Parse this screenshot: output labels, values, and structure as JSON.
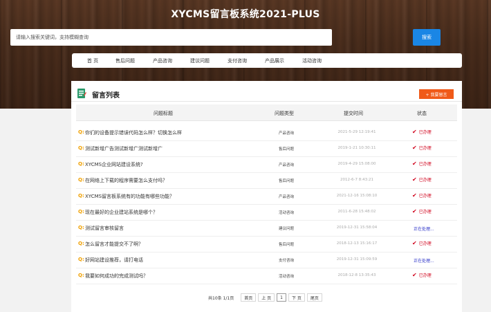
{
  "site": {
    "title": "XYCMS留言板系统2021-PLUS"
  },
  "search": {
    "placeholder": "请输入搜索关键词，支持模糊查询",
    "button_label": "搜索"
  },
  "nav": {
    "items": [
      "首 页",
      "售后问题",
      "产品咨询",
      "建议问题",
      "支付咨询",
      "产品展示",
      "活动咨询"
    ]
  },
  "panel": {
    "title": "留言列表",
    "post_button": "+ 我要留言"
  },
  "table": {
    "headers": [
      "问题标题",
      "问题类型",
      "提交时间",
      "状态"
    ],
    "rows": [
      {
        "title": "你们的设备提示错误代码怎么样？切换怎么样",
        "type": "产品咨询",
        "time": "2021-5-29 12:19:41",
        "status": "已办理",
        "status_kind": "done"
      },
      {
        "title": "测试新增广告测试新增广测试新增广",
        "type": "售后问题",
        "time": "2019-1-21 10:30:11",
        "status": "已办理",
        "status_kind": "done"
      },
      {
        "title": "XYCMS企业网站建设系统?",
        "type": "产品咨询",
        "time": "2019-4-29 15:08:00",
        "status": "已办理",
        "status_kind": "done"
      },
      {
        "title": "在网络上下载的程序需要怎么支付吗？",
        "type": "售后问题",
        "time": "2012-6-7 8:43:21",
        "status": "已办理",
        "status_kind": "done"
      },
      {
        "title": "XYCMS留言板系统有的功能有哪些功能？",
        "type": "产品咨询",
        "time": "2021-12-16 15:08:10",
        "status": "已办理",
        "status_kind": "done"
      },
      {
        "title": "现在最好的企业建站系统是哪个？",
        "type": "活动咨询",
        "time": "2011-6-28 15:48:02",
        "status": "已办理",
        "status_kind": "done"
      },
      {
        "title": "测试留言审核留言",
        "type": "建议问题",
        "time": "2019-12-31 15:58:04",
        "status": "正在处理...",
        "status_kind": "pending"
      },
      {
        "title": "怎么留言才能提交不了啊？",
        "type": "售后问题",
        "time": "2018-12-13 15:16:17",
        "status": "已办理",
        "status_kind": "done"
      },
      {
        "title": "好网站建设推荐，请打电话",
        "type": "支付咨询",
        "time": "2019-12-31 15:09:59",
        "status": "正在处理...",
        "status_kind": "pending"
      },
      {
        "title": "我要如何成功的完成测试吗？",
        "type": "活动咨询",
        "time": "2018-12-8 13:35:43",
        "status": "已办理",
        "status_kind": "done"
      }
    ]
  },
  "pager": {
    "info": "共10条 1/1页",
    "first": "首页",
    "prev": "上 页",
    "current": "1",
    "next": "下 页",
    "last": "尾页"
  },
  "colors": {
    "accent": "#1a86e5",
    "post_button": "#f05a19",
    "done": "#d0021b",
    "pending": "#2a31c8",
    "question_mark": "#f0a000"
  }
}
